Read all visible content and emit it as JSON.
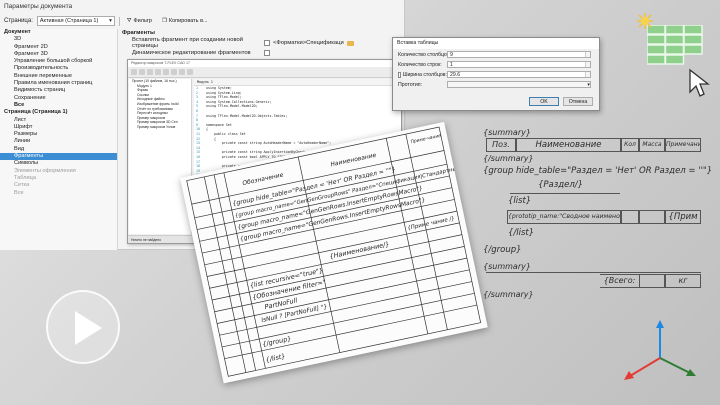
{
  "window": {
    "title": "Параметры документа"
  },
  "toolbar": {
    "page_label": "Страница:",
    "page_value": "Активная (Страница 1)",
    "filter_label": "Фильтр",
    "copy_label": "Копировать в..."
  },
  "sidebar": {
    "items": [
      {
        "label": "Документ",
        "level": 0
      },
      {
        "label": "3D",
        "level": 1
      },
      {
        "label": "Фрагмент 2D",
        "level": 1
      },
      {
        "label": "Фрагмент 3D",
        "level": 1
      },
      {
        "label": "Управление большой сборкой",
        "level": 1
      },
      {
        "label": "Производительность",
        "level": 1
      },
      {
        "label": "Внешние переменные",
        "level": 1
      },
      {
        "label": "Правила именования страниц",
        "level": 1
      },
      {
        "label": "Видимость страниц",
        "level": 1
      },
      {
        "label": "Сохранение",
        "level": 1
      },
      {
        "label": "Все",
        "level": 1,
        "bold": true
      },
      {
        "label": "Страница (Страница 1)",
        "level": 0
      },
      {
        "label": "Лист",
        "level": 1
      },
      {
        "label": "Шрифт",
        "level": 1
      },
      {
        "label": "Размеры",
        "level": 1
      },
      {
        "label": "Линии",
        "level": 1
      },
      {
        "label": "Вид",
        "level": 1
      },
      {
        "label": "Фрагменты",
        "level": 1,
        "selected": true
      },
      {
        "label": "Символы",
        "level": 1
      },
      {
        "label": "Элементы оформления",
        "level": 1,
        "disabled": true
      },
      {
        "label": "Таблица",
        "level": 1,
        "disabled": true
      },
      {
        "label": "Сетка",
        "level": 1,
        "disabled": true
      },
      {
        "label": "Все",
        "level": 1,
        "disabled": true
      }
    ]
  },
  "props": {
    "group": "Фрагменты",
    "row1_label": "Вставлять фрагмент при создании новой страницы",
    "row1_value": "<Форматки>Спецификаци",
    "row2_label": "Динамическое редактирование фрагментов"
  },
  "ide": {
    "title": "Редактор макросов T-FLEX CAD 17",
    "tab": "Модуль 1",
    "status": "Ничего не найдено",
    "tree": [
      "Проект (10 файлов, 16 тыс.)",
      "Модуль 1",
      "Формы",
      "Ссылки",
      "Исходные файлы",
      "Изображение фрагм. build",
      "Отчёт по требованиям",
      "Пересчёт исходных",
      "Пример макросов",
      "Пример макросов 3D Сен",
      "Пример макросов Узлов"
    ],
    "code": [
      {
        "n": "1",
        "t": "using System;"
      },
      {
        "n": "2",
        "t": "using System.Linq;"
      },
      {
        "n": "3",
        "t": "using TFlex.Model;"
      },
      {
        "n": "4",
        "t": "using System.Collections.Generic;"
      },
      {
        "n": "5",
        "t": "using TFlex.Model.Model2D;"
      },
      {
        "n": "6",
        "t": ""
      },
      {
        "n": "7",
        "t": "using TFlex.Model.Model2D.Objects.Tables;"
      },
      {
        "n": "8",
        "t": ""
      },
      {
        "n": "9",
        "t": "namespace Set"
      },
      {
        "n": "10",
        "t": "{"
      },
      {
        "n": "11",
        "t": "    public class Set"
      },
      {
        "n": "12",
        "t": "    {"
      },
      {
        "n": "13",
        "t": "        private const string AutoHeaderName = \"AutoHeaderName\";"
      },
      {
        "n": "14",
        "t": ""
      },
      {
        "n": "15",
        "t": "        private const string ApplyInsertionByCheck = \"ApplyInsertion\";"
      },
      {
        "n": "16",
        "t": "        private const bool APPLY_TO_SINGLE_DETAIL = false;"
      },
      {
        "n": "17",
        "t": ""
      },
      {
        "n": "18",
        "t": "        private const string OfferInsertions = \"CompleteInsertions\";"
      },
      {
        "n": "19",
        "t": "        private const OFFSET_DEFAULT = 0;"
      },
      {
        "n": "20",
        "t": "        private const OFFSET_SCALE = 1;"
      },
      {
        "n": "21",
        "t": ""
      },
      {
        "n": "22",
        "t": "        private const string SET_PARAMETER_NAME = \"ParameterName\";"
      },
      {
        "n": "23",
        "t": "        private const string SET_NAME = \"SetName\";"
      },
      {
        "n": "24",
        "t": ""
      },
      {
        "n": "25",
        "t": "        private static Dictionary<string, string> Original;"
      }
    ]
  },
  "insert_dialog": {
    "title": "Вставка таблицы",
    "cols_label": "Количество столбцов:",
    "cols_value": "9",
    "rows_label": "Количество строк:",
    "rows_value": "1",
    "width_label": "Ширина столбцов:",
    "width_value": "29.6",
    "proto_label": "Прототип:",
    "proto_value": "",
    "ok": "OK",
    "cancel": "Отмена"
  },
  "paper": {
    "head_designation": "Обозначение",
    "head_name": "Наименование",
    "head_note": "Приме-чание",
    "lines": [
      "{group hide_table=\"Раздел = 'Нет' OR Раздел = ''\"}",
      "{group macro_name=\"GenGenGroupRows\" Раздел=\"Спецификация|Стандартные изделия\"}",
      "{group macro_name=\"GenGenRows.InsertEmptyRowsMacro\"}",
      "{group macro_name=\"GenGenRows.InsertEmptyRowsMacro\"}",
      "{list recursive=\"true\"}",
      "{Обозначение filter=\"",
      "PartNoFull",
      "IsNull ? [PartNoFull] \"}",
      "{/group}",
      "{/list}",
      "{Наименование/}",
      "{Приме чание /}"
    ]
  },
  "template": {
    "summary": "{summary}",
    "poz": "Поз.",
    "name": "Наименование",
    "kol": "Кол",
    "massa": "Масса",
    "prim": "Примечание",
    "end_summary": "{/summary}",
    "group": "{group hide_table=\"Раздел = 'Нет' OR Раздел = ''\"}",
    "razdel": "{Раздел/}",
    "list": "{list}",
    "prototip": "{prototip_name:\"Сводное наименование\"/}",
    "prim2": "{Прим",
    "end_list": "{/list}",
    "end_group": "{/group}",
    "summary2": "{summary}",
    "vsego": "{Всего:",
    "kg": "кг",
    "end_summary2": "{/summary}"
  },
  "colors": {
    "accent": "#3b8ed3",
    "table_icon": "#8ed08c",
    "axis_x": "#e53935",
    "axis_y": "#2e7d32",
    "axis_z": "#1e88e5"
  }
}
